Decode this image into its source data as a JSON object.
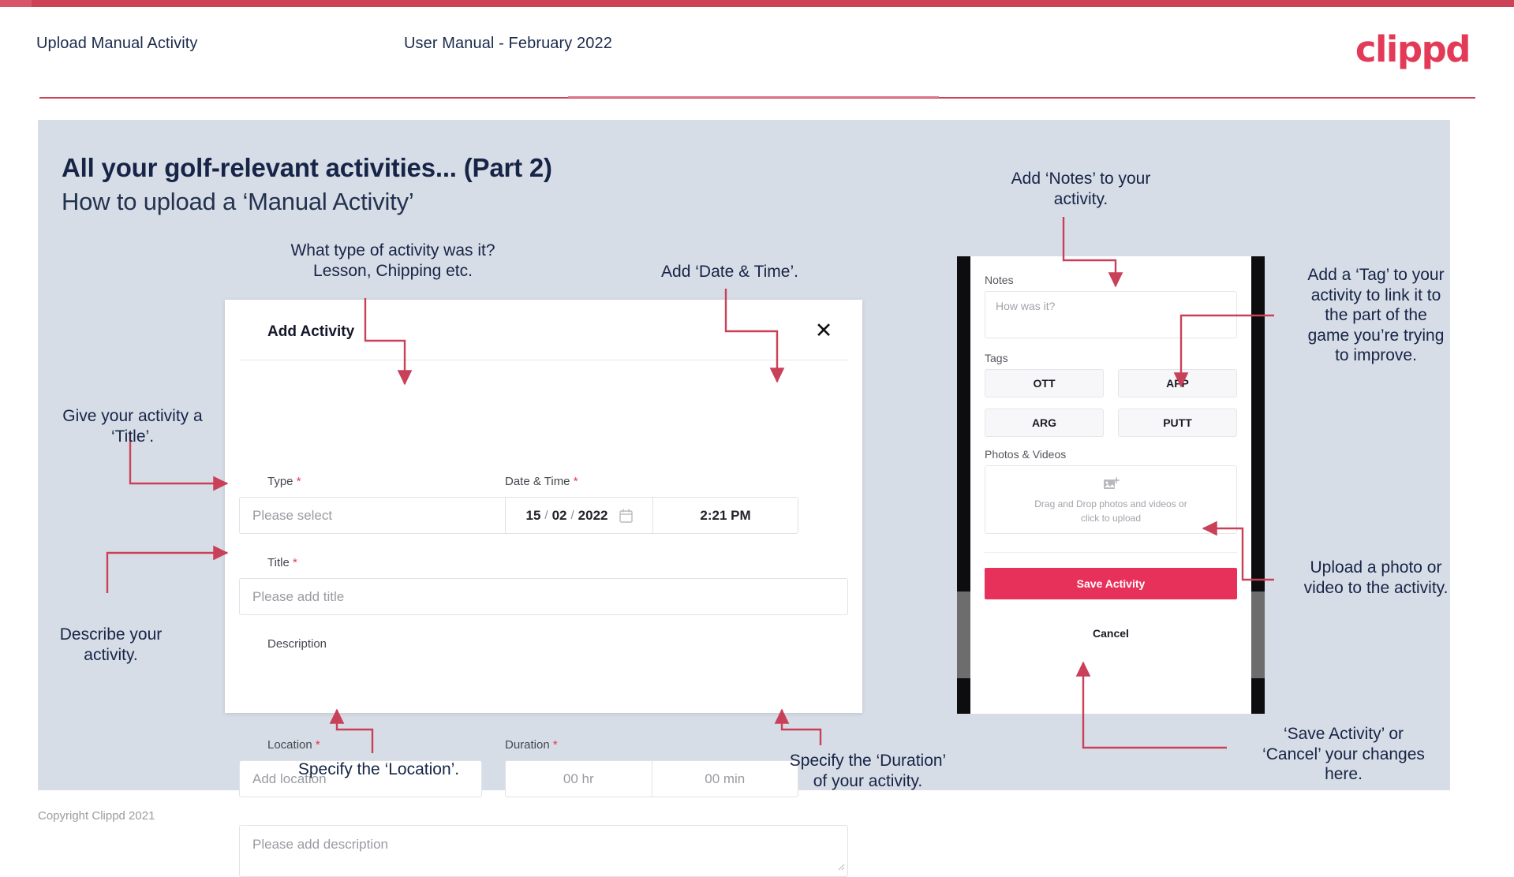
{
  "colors": {
    "brand": "#e8315a",
    "header_rule": "#c9435a",
    "slide_bg": "#d7dde6",
    "ink": "#162447",
    "arrow": "#c94159"
  },
  "header": {
    "title": "Upload Manual Activity",
    "subtitle": "User Manual - February 2022",
    "logo": "clippd"
  },
  "slide": {
    "heading": "All your golf-relevant activities... (Part 2)",
    "subheading": "How to upload a ‘Manual Activity’"
  },
  "dialog": {
    "title": "Add Activity",
    "close_icon": "close-icon",
    "type": {
      "label": "Type",
      "required": "*",
      "placeholder": "Please select",
      "chevron": "chevron-down-icon"
    },
    "datetime": {
      "label": "Date & Time",
      "required": "*",
      "day": "15",
      "month": "02",
      "year": "2022",
      "sep": "/",
      "calendar_icon": "calendar-icon",
      "time": "2:21 PM"
    },
    "title_field": {
      "label": "Title",
      "required": "*",
      "placeholder": "Please add title"
    },
    "description": {
      "label": "Description",
      "placeholder": "Please add description"
    },
    "location": {
      "label": "Location",
      "required": "*",
      "placeholder": "Add location"
    },
    "duration": {
      "label": "Duration",
      "required": "*",
      "hours": "00 hr",
      "minutes": "00 min"
    }
  },
  "phone": {
    "notes": {
      "label": "Notes",
      "placeholder": "How was it?"
    },
    "tags": {
      "label": "Tags",
      "items": [
        "OTT",
        "APP",
        "ARG",
        "PUTT"
      ]
    },
    "photos": {
      "label": "Photos & Videos",
      "icon": "add-image-icon",
      "line1": "Drag and Drop photos and videos or",
      "line2": "click to upload"
    },
    "save_label": "Save Activity",
    "cancel_label": "Cancel"
  },
  "annotations": {
    "type": "What type of activity was it?\nLesson, Chipping etc.",
    "datetime": "Add ‘Date & Time’.",
    "title": "Give your activity a\n‘Title’.",
    "description": "Describe your\nactivity.",
    "location": "Specify the ‘Location’.",
    "duration": "Specify the ‘Duration’\nof your activity.",
    "notes": "Add ‘Notes’ to your\nactivity.",
    "tag": "Add a ‘Tag’ to your\nactivity to link it to\nthe part of the\ngame you’re trying\nto improve.",
    "upload": "Upload a photo or\nvideo to the activity.",
    "save": "‘Save Activity’ or\n‘Cancel’ your changes\nhere."
  },
  "footer": {
    "copyright": "Copyright Clippd 2021"
  }
}
